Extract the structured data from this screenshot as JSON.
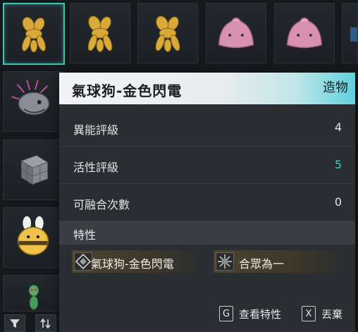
{
  "inventory": {
    "slots": [
      {
        "icon": "golden-balloon-dog-icon"
      },
      {
        "icon": "golden-balloon-dog-icon"
      },
      {
        "icon": "golden-balloon-dog-icon"
      },
      {
        "icon": "pink-blob-creature-icon"
      },
      {
        "icon": "pink-blob-creature-icon"
      },
      {
        "icon": "blue-item-icon"
      },
      {
        "icon": "spiky-skull-creature-icon"
      },
      {
        "icon": "metal-cube-icon"
      },
      {
        "icon": "bee-plush-icon"
      },
      {
        "icon": "green-lizard-figure-icon"
      }
    ],
    "filter_icon": "filter-icon",
    "sort_icon": "sort-icon"
  },
  "tooltip": {
    "name": "氣球狗-金色閃電",
    "type": "造物",
    "stats": [
      {
        "label": "異能評級",
        "value": "4"
      },
      {
        "label": "活性評級",
        "value": "5"
      },
      {
        "label": "可融合次數",
        "value": "0"
      }
    ],
    "traits_title": "特性",
    "traits": [
      {
        "label": "氣球狗-金色閃電",
        "icon": "diamond-rune-icon"
      },
      {
        "label": "合眾為一",
        "icon": "starburst-icon"
      }
    ],
    "actions": [
      {
        "key": "G",
        "label": "查看特性"
      },
      {
        "key": "X",
        "label": "丟棄"
      }
    ]
  },
  "colors": {
    "accent": "#38c6b3",
    "active_value": "#3fd0c0"
  }
}
